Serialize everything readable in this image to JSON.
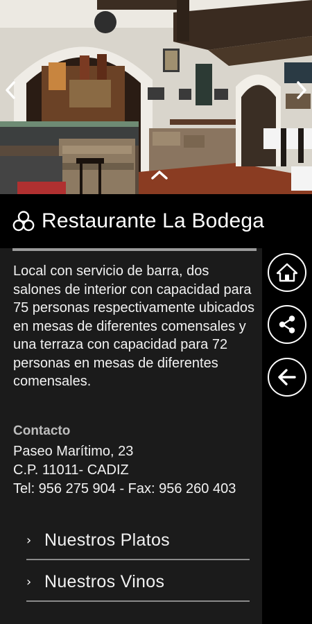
{
  "hero": {
    "alt": "Restaurant interior photo",
    "prev_icon": "chevron-left-icon",
    "next_icon": "chevron-right-icon",
    "collapse_icon": "chevron-up-icon"
  },
  "header": {
    "icon": "three-circles-icon",
    "title": "Restaurante La Bodega"
  },
  "description": "Local con servicio de barra, dos salones de interior con capacidad para 75 personas respectivamente ubicados en mesas de diferentes comensales y una terraza con capacidad para 72 personas en mesas de diferentes comensales.",
  "contact": {
    "heading": "Contacto",
    "address": "Paseo Marítimo, 23",
    "postal": "C.P. 11011- CADIZ",
    "phone": "Tel: 956 275 904 - Fax: 956 260 403"
  },
  "menu": [
    {
      "label": "Nuestros Platos",
      "icon": "chevron-right-icon"
    },
    {
      "label": "Nuestros Vinos",
      "icon": "chevron-right-icon"
    }
  ],
  "actions": [
    {
      "icon": "home-icon"
    },
    {
      "icon": "share-icon"
    },
    {
      "icon": "back-arrow-icon"
    }
  ],
  "colors": {
    "panel": "#1b1b1b",
    "background": "#000000",
    "text": "#f2f2f2",
    "heading_gray": "#bdbdbd",
    "divider": "#9a9a9a"
  }
}
